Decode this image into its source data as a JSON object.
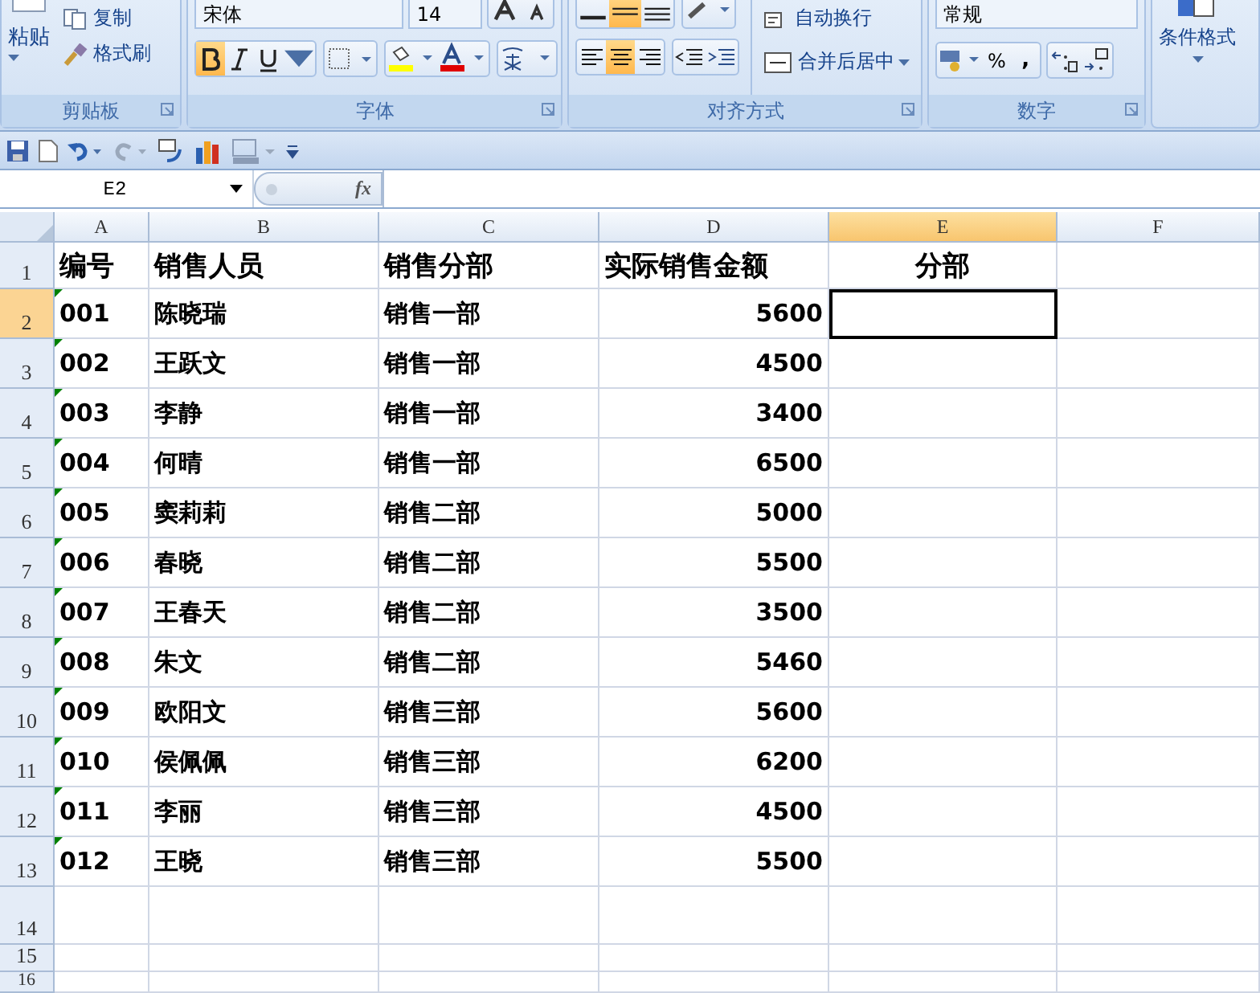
{
  "ribbon": {
    "clipboard": {
      "paste": "粘贴",
      "copy": "复制",
      "format_painter": "格式刷",
      "label": "剪贴板"
    },
    "font": {
      "font_name": "宋体",
      "font_size": "14",
      "label": "字体",
      "styles": [
        {
          "kind": "bold",
          "selected": true
        },
        {
          "kind": "italic",
          "selected": false
        },
        {
          "kind": "underline",
          "selected": false
        }
      ]
    },
    "alignment": {
      "wrap_text": "自动换行",
      "merge": "合并后居中",
      "label": "对齐方式",
      "horizontal": [
        {
          "kind": "left",
          "selected": false
        },
        {
          "kind": "center",
          "selected": true
        },
        {
          "kind": "right",
          "selected": false
        }
      ]
    },
    "number": {
      "format": "常规",
      "percent": "%",
      "comma": ",",
      "label": "数字"
    },
    "styles": {
      "conditional_format": "条件格式"
    }
  },
  "formula_bar": {
    "name_box": "E2",
    "fx": "fx"
  },
  "sheet": {
    "columns": [
      {
        "label": "A",
        "selected": false
      },
      {
        "label": "B",
        "selected": false
      },
      {
        "label": "C",
        "selected": false
      },
      {
        "label": "D",
        "selected": false
      },
      {
        "label": "E",
        "selected": true
      },
      {
        "label": "F",
        "selected": false
      }
    ],
    "rows": [
      {
        "num": "1",
        "selected": false,
        "text_flag": false,
        "cells": [
          "编号",
          "销售人员",
          "销售分部",
          "实际销售金额",
          "分部",
          ""
        ]
      },
      {
        "num": "2",
        "selected": true,
        "text_flag": true,
        "cells": [
          "001",
          "陈晓瑞",
          "销售一部",
          "5600",
          "",
          ""
        ]
      },
      {
        "num": "3",
        "selected": false,
        "text_flag": true,
        "cells": [
          "002",
          "王跃文",
          "销售一部",
          "4500",
          "",
          ""
        ]
      },
      {
        "num": "4",
        "selected": false,
        "text_flag": true,
        "cells": [
          "003",
          "李静",
          "销售一部",
          "3400",
          "",
          ""
        ]
      },
      {
        "num": "5",
        "selected": false,
        "text_flag": true,
        "cells": [
          "004",
          "何晴",
          "销售一部",
          "6500",
          "",
          ""
        ]
      },
      {
        "num": "6",
        "selected": false,
        "text_flag": true,
        "cells": [
          "005",
          "窦莉莉",
          "销售二部",
          "5000",
          "",
          ""
        ]
      },
      {
        "num": "7",
        "selected": false,
        "text_flag": true,
        "cells": [
          "006",
          "春晓",
          "销售二部",
          "5500",
          "",
          ""
        ]
      },
      {
        "num": "8",
        "selected": false,
        "text_flag": true,
        "cells": [
          "007",
          "王春天",
          "销售二部",
          "3500",
          "",
          ""
        ]
      },
      {
        "num": "9",
        "selected": false,
        "text_flag": true,
        "cells": [
          "008",
          "朱文",
          "销售二部",
          "5460",
          "",
          ""
        ]
      },
      {
        "num": "10",
        "selected": false,
        "text_flag": true,
        "cells": [
          "009",
          "欧阳文",
          "销售三部",
          "5600",
          "",
          ""
        ]
      },
      {
        "num": "11",
        "selected": false,
        "text_flag": true,
        "cells": [
          "010",
          "侯佩佩",
          "销售三部",
          "6200",
          "",
          ""
        ]
      },
      {
        "num": "12",
        "selected": false,
        "text_flag": true,
        "cells": [
          "011",
          "李丽",
          "销售三部",
          "4500",
          "",
          ""
        ]
      },
      {
        "num": "13",
        "selected": false,
        "text_flag": true,
        "cells": [
          "012",
          "王晓",
          "销售三部",
          "5500",
          "",
          ""
        ]
      },
      {
        "num": "14",
        "selected": false,
        "text_flag": false,
        "cells": [
          "",
          "",
          "",
          "",
          "",
          ""
        ]
      },
      {
        "num": "15",
        "selected": false,
        "text_flag": false,
        "cells": [
          "",
          "",
          "",
          "",
          "",
          ""
        ]
      },
      {
        "num": "16",
        "selected": false,
        "text_flag": false,
        "cells": [
          "",
          "",
          "",
          "",
          "",
          ""
        ]
      }
    ]
  }
}
